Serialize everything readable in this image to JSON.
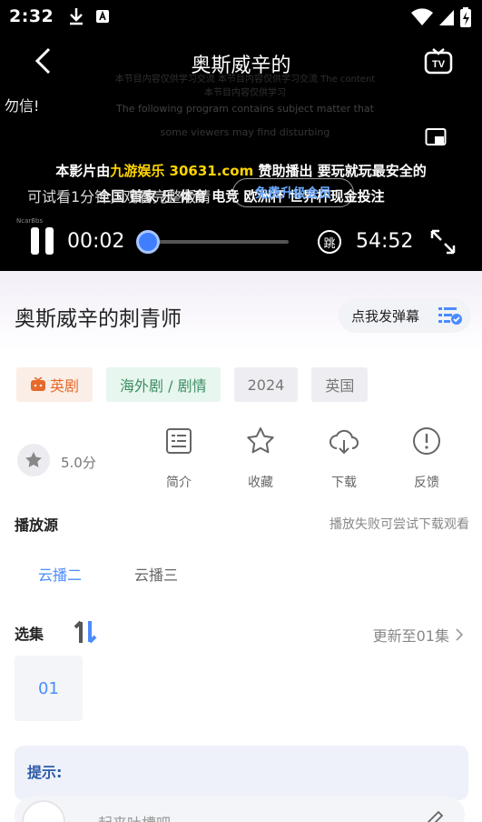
{
  "status_bar": {
    "time": "2:32"
  },
  "player": {
    "title": "奥斯威辛的",
    "watermark_left": "勿信!",
    "dim_line_1": "本节目内容仅供学习交流 本节目内容仅供学习交流 The content",
    "dim_line_2": "本节目内容仅供学习",
    "dim_line_3": "The following program contains subject matter that",
    "dim_line_4": "some viewers may find disturbing",
    "ad_line1_prefix": "本影片由",
    "ad_line1_highlight": "九游娱乐 30631.com",
    "ad_line1_suffix": " 赞助播出 要玩就玩最安全的",
    "ad_line2": "全国   首家  乐 体育  电竞  欧洲杯  世界杯现金投注",
    "ad_overlay_left": "可试看1分钟，观看完整版请",
    "ad_pill": "免费升级会员",
    "brand_tiny": "NcarBbs",
    "time_current": "00:02",
    "progress_fraction": 0.02,
    "jump_label": "跳",
    "time_total": "54:52"
  },
  "detail": {
    "title": "奥斯威辛的刺青师",
    "danmaku_button": "点我发弹幕",
    "tags": [
      {
        "label": "英剧",
        "style": "orange",
        "icon": "tv-icon"
      },
      {
        "label": "海外剧 / 剧情",
        "style": "green"
      },
      {
        "label": "2024",
        "style": "gray"
      },
      {
        "label": "英国",
        "style": "gray"
      }
    ],
    "rating": "5.0分",
    "actions": [
      {
        "label": "简介",
        "icon": "intro-icon"
      },
      {
        "label": "收藏",
        "icon": "star-icon"
      },
      {
        "label": "下载",
        "icon": "cloud-download-icon"
      },
      {
        "label": "反馈",
        "icon": "feedback-icon"
      }
    ],
    "source_label": "播放源",
    "source_hint": "播放失败可尝试下载观看",
    "sources": [
      "云播二",
      "云播三"
    ],
    "episodes_label": "选集",
    "update_text": "更新至01集",
    "episodes": [
      "01"
    ],
    "tip_title": "提示:",
    "comment_placeholder": "起来吐槽吧"
  },
  "colors": {
    "accent": "#4a8cff",
    "orange_tag": "#e56a2b",
    "green_tag": "#3c8e62",
    "ad_highlight": "#ffd400"
  }
}
